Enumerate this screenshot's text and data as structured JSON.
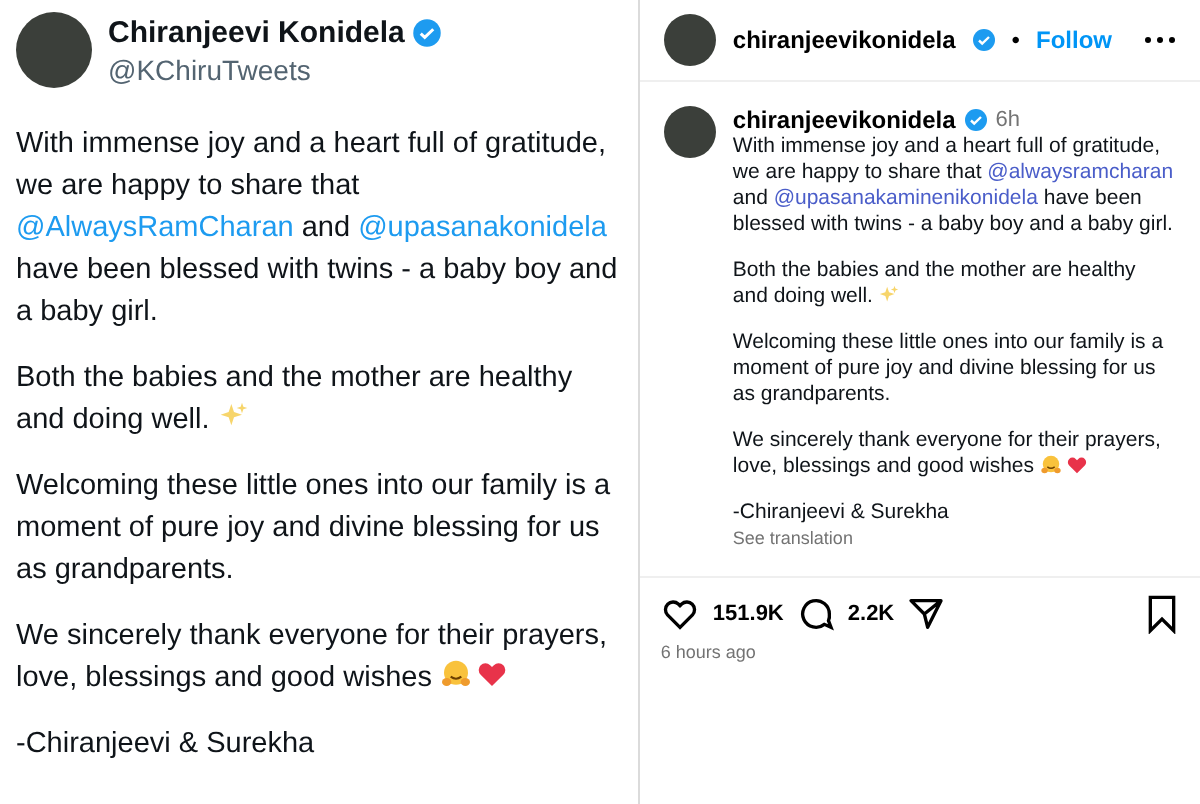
{
  "tweet": {
    "author": {
      "name": "Chiranjeevi Konidela",
      "handle": "@KChiruTweets",
      "verified": true
    },
    "paragraphs": [
      {
        "segments": [
          {
            "text": "With immense joy and a heart full of gratitude, we are happy to share that ",
            "kind": "plain"
          },
          {
            "text": "@AlwaysRamCharan",
            "kind": "mention"
          },
          {
            "text": " and ",
            "kind": "plain"
          },
          {
            "text": "@upasanakonidela",
            "kind": "mention"
          },
          {
            "text": " have been blessed with twins - a baby boy and a baby girl.",
            "kind": "plain"
          }
        ]
      },
      {
        "segments": [
          {
            "text": "Both the babies and the mother are healthy and doing well.",
            "kind": "plain"
          }
        ],
        "emojis": [
          {
            "kind": "sparkles"
          }
        ]
      },
      {
        "segments": [
          {
            "text": "Welcoming these little ones into our family is a moment of pure joy and divine blessing for us as grandparents.",
            "kind": "plain"
          }
        ]
      },
      {
        "segments": [
          {
            "text": "We sincerely thank everyone for their prayers, love, blessings and good wishes",
            "kind": "plain"
          }
        ],
        "emojis": [
          {
            "kind": "hug"
          },
          {
            "kind": "heart"
          }
        ]
      },
      {
        "segments": [
          {
            "text": "-Chiranjeevi & Surekha",
            "kind": "plain"
          }
        ]
      }
    ]
  },
  "instagram": {
    "header": {
      "username": "chiranjeevikonidela",
      "verified": true,
      "separator": "•",
      "follow": "Follow"
    },
    "caption": {
      "username": "chiranjeevikonidela",
      "verified": true,
      "time": "6h",
      "paragraphs": [
        {
          "segments": [
            {
              "text": "With immense joy and a heart full of gratitude, we are happy to share that ",
              "kind": "plain"
            },
            {
              "text": "@alwaysramcharan",
              "kind": "mention"
            },
            {
              "text": " and ",
              "kind": "plain"
            },
            {
              "text": "@upasanakaminenikonidela",
              "kind": "mention"
            },
            {
              "text": " have been blessed with twins - a baby boy and a baby girl.",
              "kind": "plain"
            }
          ]
        },
        {
          "segments": [
            {
              "text": "Both the babies and the mother are healthy and doing well.",
              "kind": "plain"
            }
          ],
          "emojis": [
            {
              "kind": "sparkles"
            }
          ]
        },
        {
          "segments": [
            {
              "text": "Welcoming these little ones into our family is a moment of pure joy and divine blessing for us as grandparents.",
              "kind": "plain"
            }
          ]
        },
        {
          "segments": [
            {
              "text": "We sincerely thank everyone for their prayers, love, blessings and good wishes",
              "kind": "plain"
            }
          ],
          "emojis": [
            {
              "kind": "hug"
            },
            {
              "kind": "heart"
            }
          ]
        },
        {
          "segments": [
            {
              "text": "-Chiranjeevi & Surekha",
              "kind": "plain"
            }
          ]
        }
      ],
      "see_translation": "See translation"
    },
    "likes": "151.9K",
    "comments": "2.2K",
    "timestamp": "6 hours ago"
  }
}
